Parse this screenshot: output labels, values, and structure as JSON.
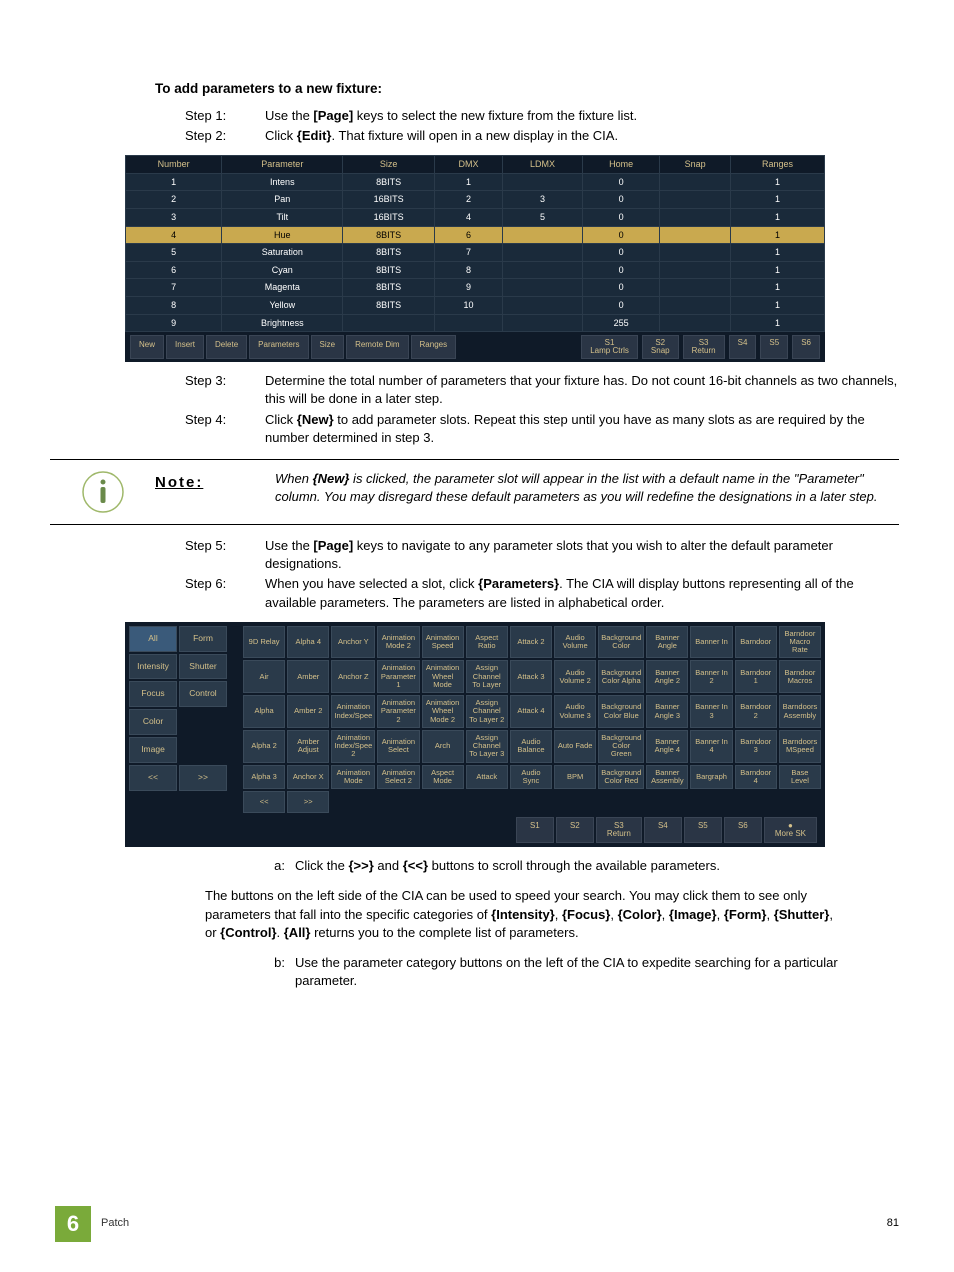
{
  "heading": "To add parameters to a new fixture:",
  "steps12": [
    {
      "label": "Step 1:",
      "before": "Use the ",
      "bold": "[Page]",
      "after": " keys to select the new fixture from the fixture list."
    },
    {
      "label": "Step 2:",
      "before": "Click ",
      "bold": "{Edit}",
      "after": ". That fixture will open in a new display in the CIA."
    }
  ],
  "table1": {
    "headers": [
      "Number",
      "Parameter",
      "Size",
      "DMX",
      "LDMX",
      "Home",
      "Snap",
      "Ranges"
    ],
    "rows": [
      {
        "n": "1",
        "p": "Intens",
        "s": "8BITS",
        "d": "1",
        "l": "",
        "h": "0",
        "sn": "",
        "r": "1",
        "hl": false
      },
      {
        "n": "2",
        "p": "Pan",
        "s": "16BITS",
        "d": "2",
        "l": "3",
        "h": "0",
        "sn": "",
        "r": "1",
        "hl": false
      },
      {
        "n": "3",
        "p": "Tilt",
        "s": "16BITS",
        "d": "4",
        "l": "5",
        "h": "0",
        "sn": "",
        "r": "1",
        "hl": false
      },
      {
        "n": "4",
        "p": "Hue",
        "s": "8BITS",
        "d": "6",
        "l": "",
        "h": "0",
        "sn": "",
        "r": "1",
        "hl": true
      },
      {
        "n": "5",
        "p": "Saturation",
        "s": "8BITS",
        "d": "7",
        "l": "",
        "h": "0",
        "sn": "",
        "r": "1",
        "hl": false
      },
      {
        "n": "6",
        "p": "Cyan",
        "s": "8BITS",
        "d": "8",
        "l": "",
        "h": "0",
        "sn": "",
        "r": "1",
        "hl": false
      },
      {
        "n": "7",
        "p": "Magenta",
        "s": "8BITS",
        "d": "9",
        "l": "",
        "h": "0",
        "sn": "",
        "r": "1",
        "hl": false
      },
      {
        "n": "8",
        "p": "Yellow",
        "s": "8BITS",
        "d": "10",
        "l": "",
        "h": "0",
        "sn": "",
        "r": "1",
        "hl": false
      },
      {
        "n": "9",
        "p": "Brightness",
        "s": "",
        "d": "",
        "l": "",
        "h": "255",
        "sn": "",
        "r": "1",
        "hl": false
      }
    ],
    "buttons_left": [
      "New",
      "Insert",
      "Delete",
      "Parameters",
      "Size",
      "Remote Dim",
      "Ranges"
    ],
    "buttons_right": [
      "S1\nLamp Ctrls",
      "S2\nSnap",
      "S3\nReturn",
      "S4",
      "S5",
      "S6"
    ]
  },
  "steps34": [
    {
      "label": "Step 3:",
      "text": "Determine the total number of parameters that your fixture has. Do not count 16-bit channels as two channels, this will be done in a later step."
    },
    {
      "label": "Step 4:",
      "before": "Click ",
      "bold": "{New}",
      "after": " to add parameter slots. Repeat this step until you have as many slots as are required by the number determined in step 3."
    }
  ],
  "note": {
    "label": "Note:",
    "body_before": "When ",
    "body_bold": "{New}",
    "body_after": " is clicked, the parameter slot will appear in the list with a default name in the \"Parameter\" column. You may disregard these default parameters as you will redefine the designations in a later step."
  },
  "steps56": [
    {
      "label": "Step 5:",
      "before": "Use the ",
      "bold": "[Page]",
      "after": " keys to navigate to any parameter slots that you wish to alter the default parameter designations."
    },
    {
      "label": "Step 6:",
      "before": "When you have selected a slot, click ",
      "bold": "{Parameters}",
      "after": ". The CIA will display buttons representing all of the available parameters. The parameters are listed in alphabetical order."
    }
  ],
  "cia": {
    "cat_rows": [
      [
        "All",
        "Form"
      ],
      [
        "Intensity",
        "Shutter"
      ],
      [
        "Focus",
        "Control"
      ],
      [
        "Color",
        ""
      ],
      [
        "Image",
        ""
      ],
      [
        "<<",
        ">>"
      ]
    ],
    "param_grid": [
      [
        "9D Relay",
        "Alpha 4",
        "Anchor Y",
        "Animation Mode 2",
        "Animation Speed",
        "Aspect Ratio",
        "Attack 2",
        "Audio Volume",
        "Background Color",
        "Banner Angle",
        "Banner In",
        "Barndoor",
        "Barndoor Macro Rate"
      ],
      [
        "Air",
        "Amber",
        "Anchor Z",
        "Animation Parameter 1",
        "Animation Wheel Mode",
        "Assign Channel To Layer",
        "Attack 3",
        "Audio Volume 2",
        "Background Color Alpha",
        "Banner Angle 2",
        "Banner In 2",
        "Barndoor 1",
        "Barndoor Macros"
      ],
      [
        "Alpha",
        "Amber 2",
        "Animation Index/Spee",
        "Animation Parameter 2",
        "Animation Wheel Mode 2",
        "Assign Channel To Layer 2",
        "Attack 4",
        "Audio Volume 3",
        "Background Color Blue",
        "Banner Angle 3",
        "Banner In 3",
        "Barndoor 2",
        "Barndoors Assembly"
      ],
      [
        "Alpha 2",
        "Amber Adjust",
        "Animation Index/Spee 2",
        "Animation Select",
        "Arch",
        "Assign Channel To Layer 3",
        "Audio Balance",
        "Auto Fade",
        "Background Color Green",
        "Banner Angle 4",
        "Banner In 4",
        "Barndoor 3",
        "Barndoors MSpeed"
      ],
      [
        "Alpha 3",
        "Anchor X",
        "Animation Mode",
        "Animation Select 2",
        "Aspect Mode",
        "Attack",
        "Audio Sync",
        "BPM",
        "Background Color Red",
        "Banner Assembly",
        "Bargraph",
        "Barndoor 4",
        "Base Level"
      ],
      [
        "<<",
        ">>",
        "",
        "",
        "",
        "",
        "",
        "",
        "",
        "",
        "",
        "",
        ""
      ]
    ],
    "softkeys": [
      "S1",
      "S2",
      "S3\nReturn",
      "S4",
      "S5",
      "S6",
      "●\nMore SK"
    ]
  },
  "sub_a": {
    "label": "a:",
    "before": "Click the ",
    "b1": "{>>}",
    "mid": " and ",
    "b2": "{<<}",
    "after": " buttons to scroll through the available parameters."
  },
  "para": {
    "t1": "The buttons on the left side of the CIA can be used to speed your search. You may click them to see only parameters that fall into the specific categories of ",
    "b1": "{Intensity}",
    "c1": ", ",
    "b2": "{Focus}",
    "c2": ", ",
    "b3": "{Color}",
    "c3": ", ",
    "b4": "{Image}",
    "c4": ", ",
    "b5": "{Form}",
    "c5": ", ",
    "b6": "{Shutter}",
    "c6": ", or ",
    "b7": "{Control}",
    "c7": ". ",
    "b8": "{All}",
    "t2": " returns you to the complete list of parameters."
  },
  "sub_b": {
    "label": "b:",
    "text": "Use the parameter category buttons on the left of the CIA to expedite searching for a particular parameter."
  },
  "footer": {
    "chapter_num": "6",
    "chapter_title": "Patch",
    "page_num": "81"
  }
}
